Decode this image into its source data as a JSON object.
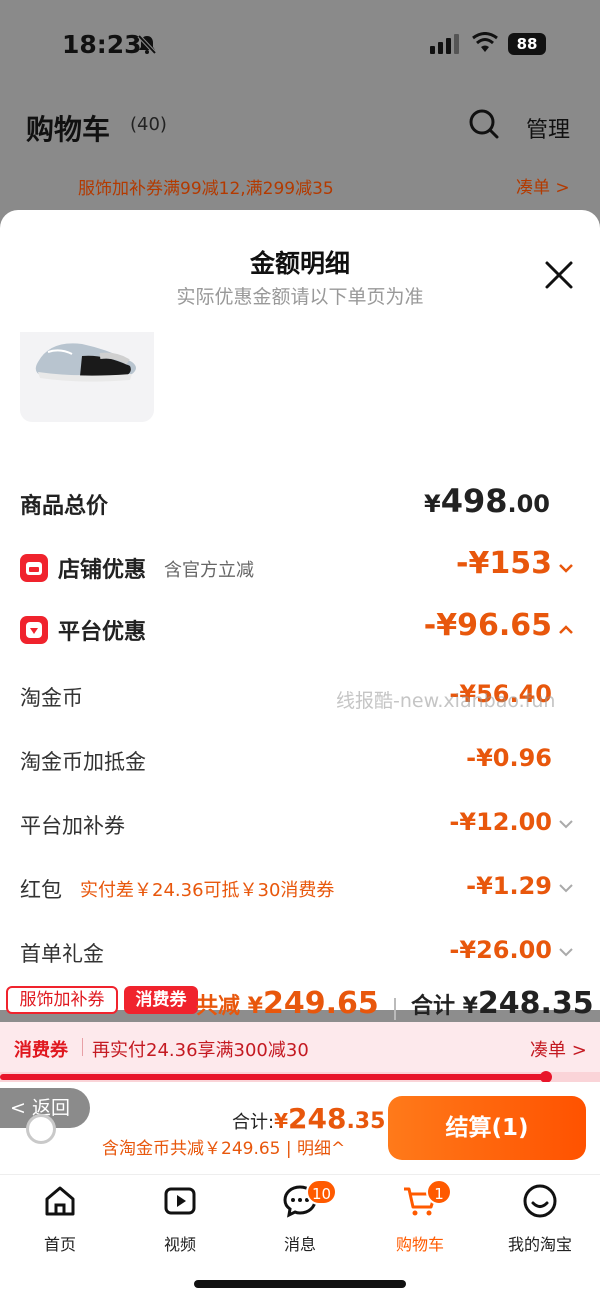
{
  "status": {
    "time": "18:23",
    "battery": "88"
  },
  "cart": {
    "title": "购物车",
    "count": "(40)",
    "manage": "管理"
  },
  "promo": {
    "text": "服饰加补券满99减12,满299减35",
    "link": "凑单 >"
  },
  "sheet": {
    "title": "金额明细",
    "subtitle": "实际优惠金额请以下单页为准",
    "total_label": "商品总价",
    "total_yen": "¥",
    "total_int": "498",
    "total_dec": ".00",
    "shop": {
      "label": "店铺优惠",
      "note": "含官方立减",
      "value": "-¥153"
    },
    "platform": {
      "label": "平台优惠",
      "value": "-¥96.65"
    },
    "items": [
      {
        "label": "淘金币",
        "value": "-¥56.40"
      },
      {
        "label": "淘金币加抵金",
        "value": "-¥0.96"
      },
      {
        "label": "平台加补券",
        "value": "-¥12.00"
      },
      {
        "label": "红包",
        "note": "实付差￥24.36可抵￥30消费券",
        "value": "-¥1.29"
      },
      {
        "label": "首单礼金",
        "value": "-¥26.00"
      }
    ],
    "watermark": "线报酷-new.xianbao.fun"
  },
  "summary": {
    "tag1": "服饰加补券",
    "tag2": "消费券",
    "save_label": "共减 ¥",
    "save_value": "249.65",
    "total_label": "合计 ¥",
    "total_value": "248.35"
  },
  "coupon": {
    "label": "消费券",
    "text": "再实付24.36享满300减30",
    "link": "凑单 >",
    "progress": 0.91
  },
  "checkout": {
    "back": "< 返回",
    "total_label": "合计:",
    "total_yen": "¥",
    "total_int": "248",
    "total_dec": ".35",
    "sub": "含淘金币共减￥249.65 | 明细^",
    "button": "结算(1)"
  },
  "tabs": [
    {
      "label": "首页",
      "icon": "home-icon"
    },
    {
      "label": "视频",
      "icon": "video-icon"
    },
    {
      "label": "消息",
      "icon": "message-icon",
      "badge": "10"
    },
    {
      "label": "购物车",
      "icon": "cart-icon",
      "badge": "1",
      "active": true
    },
    {
      "label": "我的淘宝",
      "icon": "profile-icon"
    }
  ],
  "colors": {
    "accent": "#ff5a00",
    "price": "#e8570c",
    "red": "#f0232d"
  }
}
